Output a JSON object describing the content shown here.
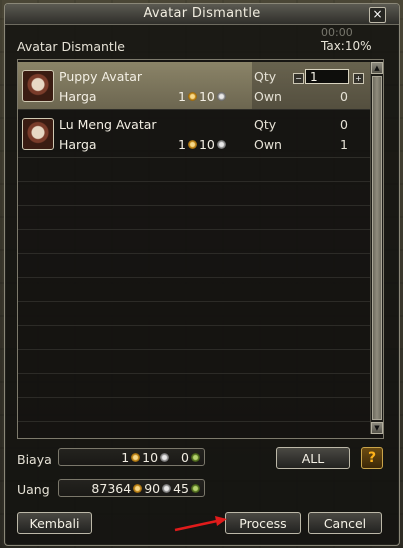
{
  "window": {
    "title": "Avatar Dismantle",
    "subtitle": "Avatar Dismantle",
    "timer": "00:00",
    "tax": "Tax:10%",
    "close_icon": "×"
  },
  "items": [
    {
      "name": "Puppy Avatar",
      "harga_label": "Harga",
      "price_gold": "1",
      "price_silver": "10",
      "qty_label": "Qty",
      "qty_value": "1",
      "own_label": "Own",
      "own_value": "0",
      "selected": true
    },
    {
      "name": "Lu Meng Avatar",
      "harga_label": "Harga",
      "price_gold": "1",
      "price_silver": "10",
      "qty_label": "Qty",
      "qty_value": "0",
      "own_label": "Own",
      "own_value": "1",
      "selected": false
    }
  ],
  "biaya": {
    "label": "Biaya",
    "gold": "1",
    "silver": "10",
    "bronze": "0"
  },
  "uang": {
    "label": "Uang",
    "gold": "87364",
    "silver": "90",
    "bronze": "45"
  },
  "buttons": {
    "all": "ALL",
    "help": "?",
    "kembali": "Kembali",
    "process": "Process",
    "cancel": "Cancel"
  },
  "colors": {
    "highlight_arrow": "#e01b1b",
    "help_accent": "#ffb31a",
    "selected_row": "#7d765c"
  },
  "icons": {
    "scroll_up": "▲",
    "scroll_down": "▼",
    "minus": "−",
    "plus": "+"
  }
}
